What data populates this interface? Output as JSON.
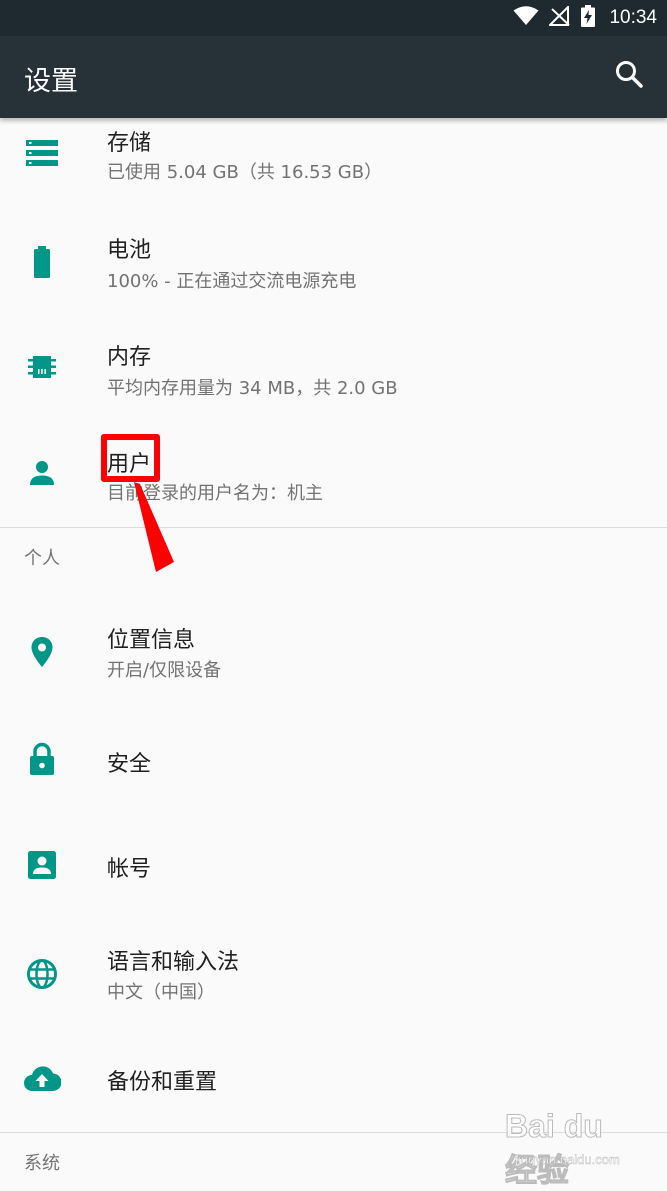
{
  "status_bar": {
    "time": "10:34",
    "icons": [
      "wifi-icon",
      "no-signal-icon",
      "battery-charging-icon"
    ]
  },
  "toolbar": {
    "title": "设置",
    "search_icon": "search-icon"
  },
  "items_device": [
    {
      "icon": "storage-icon",
      "title": "存储",
      "summary": "已使用 5.04 GB（共 16.53 GB）"
    },
    {
      "icon": "battery-icon",
      "title": "电池",
      "summary": "100% - 正在通过交流电源充电"
    },
    {
      "icon": "memory-icon",
      "title": "内存",
      "summary": "平均内存用量为 34 MB，共 2.0 GB"
    },
    {
      "icon": "user-icon",
      "title": "用户",
      "summary": "目前登录的用户名为：机主"
    }
  ],
  "section_personal": "个人",
  "items_personal": [
    {
      "icon": "location-icon",
      "title": "位置信息",
      "summary": "开启/仅限设备"
    },
    {
      "icon": "lock-icon",
      "title": "安全",
      "summary": ""
    },
    {
      "icon": "account-icon",
      "title": "帐号",
      "summary": ""
    },
    {
      "icon": "globe-icon",
      "title": "语言和输入法",
      "summary": "中文（中国）"
    },
    {
      "icon": "cloud-upload-icon",
      "title": "备份和重置",
      "summary": ""
    }
  ],
  "section_system": "系统",
  "colors": {
    "accent": "#009688",
    "toolbar": "#263238",
    "statusbar": "#1f2a30",
    "annotation": "#ff0000"
  },
  "watermark": {
    "logo": "Bai du 经验",
    "sub": "jingyan.baidu.com"
  }
}
